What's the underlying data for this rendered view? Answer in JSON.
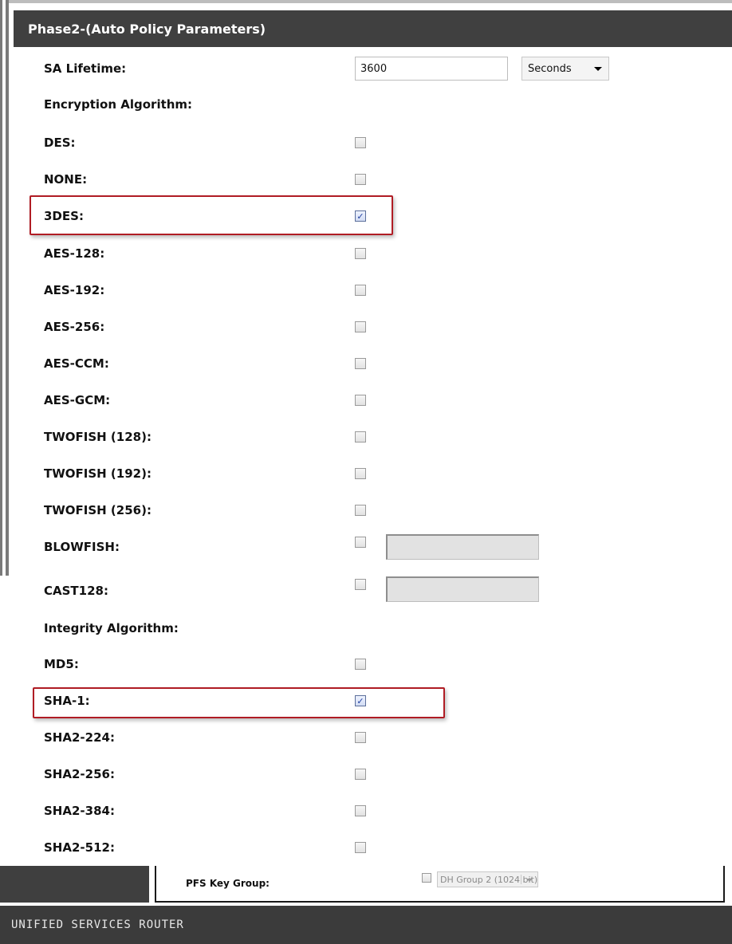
{
  "section": {
    "title": "Phase2-(Auto Policy Parameters)"
  },
  "sa_lifetime": {
    "label": "SA Lifetime:",
    "value": "3600",
    "unit": "Seconds"
  },
  "encryption": {
    "heading": "Encryption Algorithm:",
    "items": [
      {
        "label": "DES:",
        "checked": false
      },
      {
        "label": "NONE:",
        "checked": false
      },
      {
        "label": "3DES:",
        "checked": true
      },
      {
        "label": "AES-128:",
        "checked": false
      },
      {
        "label": "AES-192:",
        "checked": false
      },
      {
        "label": "AES-256:",
        "checked": false
      },
      {
        "label": "AES-CCM:",
        "checked": false
      },
      {
        "label": "AES-GCM:",
        "checked": false
      },
      {
        "label": "TWOFISH (128):",
        "checked": false
      },
      {
        "label": "TWOFISH (192):",
        "checked": false
      },
      {
        "label": "TWOFISH (256):",
        "checked": false
      },
      {
        "label": "BLOWFISH:",
        "checked": false
      },
      {
        "label": "CAST128:",
        "checked": false
      }
    ]
  },
  "integrity": {
    "heading": "Integrity Algorithm:",
    "items": [
      {
        "label": "MD5:",
        "checked": false
      },
      {
        "label": "SHA-1:",
        "checked": true
      },
      {
        "label": "SHA2-224:",
        "checked": false
      },
      {
        "label": "SHA2-256:",
        "checked": false
      },
      {
        "label": "SHA2-384:",
        "checked": false
      },
      {
        "label": "SHA2-512:",
        "checked": false
      }
    ]
  },
  "pfs": {
    "label": "PFS Key Group:",
    "checked": false,
    "group": "DH Group 2 (1024 bit)"
  },
  "footer": {
    "brand": "UNIFIED SERVICES ROUTER"
  },
  "colors": {
    "header_bg": "#404040",
    "highlight": "#b01c24",
    "footer_bg": "#3b3b3b"
  }
}
